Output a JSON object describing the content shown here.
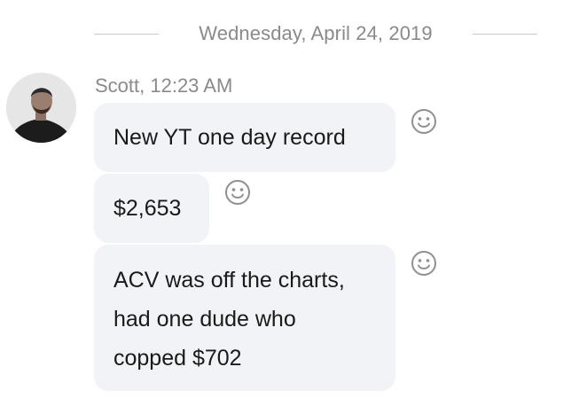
{
  "date_divider": "Wednesday, April 24, 2019",
  "message_group": {
    "sender_line": "Scott, 12:23 AM",
    "messages": [
      {
        "lines": [
          "New YT one day record"
        ]
      },
      {
        "lines": [
          "$2,653"
        ]
      },
      {
        "lines": [
          "ACV was off the charts,",
          "had one dude who",
          "copped $702"
        ]
      }
    ],
    "reaction_icon": "smiley-face-icon"
  },
  "colors": {
    "bubble": "#f1f3f6",
    "meta_text": "#8a8a8a",
    "icon": "#8f8f8f"
  }
}
